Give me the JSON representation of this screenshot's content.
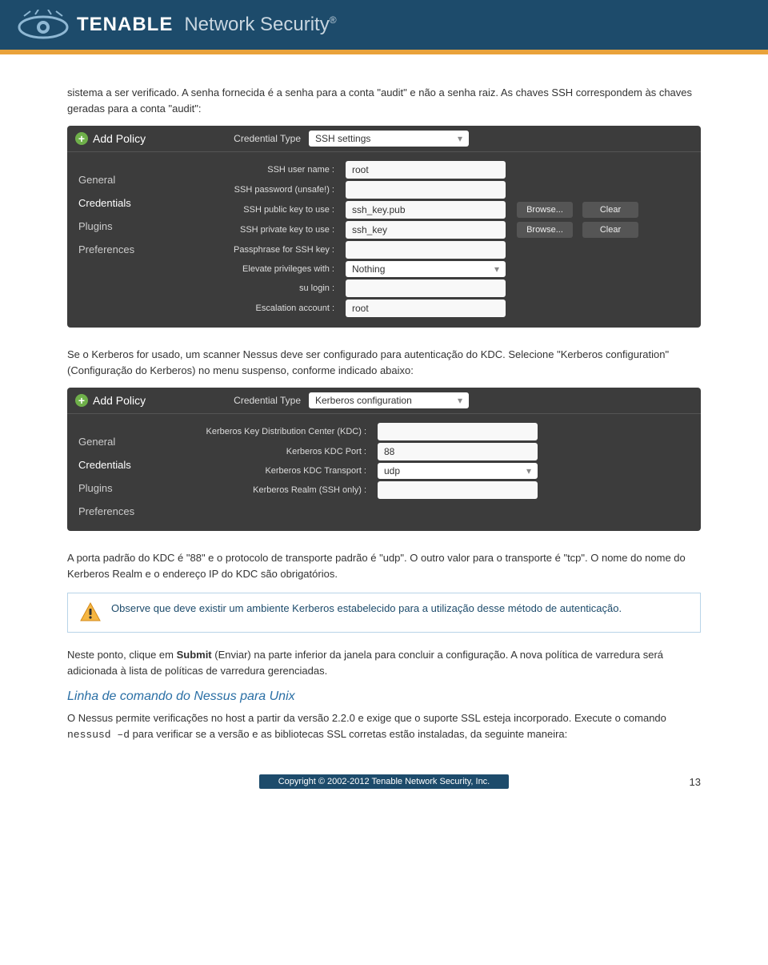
{
  "header": {
    "brand": "TENABLE",
    "tagline": "Network Security"
  },
  "body": {
    "p1": "sistema a ser verificado. A senha fornecida é a senha para a conta \"audit\" e não a senha raiz. As chaves SSH correspondem às chaves geradas para a conta \"audit\":",
    "p2": "Se o Kerberos for usado, um scanner Nessus deve ser configurado para autenticação do KDC. Selecione \"Kerberos configuration\" (Configuração do Kerberos) no menu suspenso, conforme indicado abaixo:",
    "p3": "A porta padrão do KDC é \"88\" e o protocolo de transporte padrão é \"udp\". O outro valor para o transporte é \"tcp\". O nome do nome do Kerberos Realm e o endereço IP do KDC são obrigatórios.",
    "note": "Observe que deve existir um ambiente Kerberos estabelecido para a utilização desse método de autenticação.",
    "p4a": "Neste ponto, clique em ",
    "p4b": "Submit",
    "p4c": " (Enviar) na parte inferior da janela para concluir a configuração. A nova política de varredura será adicionada à lista de políticas de varredura gerenciadas.",
    "h1": "Linha de comando do Nessus para Unix",
    "p5a": "O Nessus permite verificações no host a partir da versão 2.2.0 e exige que o suporte SSL esteja incorporado. Execute o comando ",
    "p5b": "nessusd –d",
    "p5c": " para verificar se a versão e as bibliotecas SSL corretas estão instaladas, da seguinte maneira:"
  },
  "ss1": {
    "add": "Add Policy",
    "credType": "Credential Type",
    "credValue": "SSH settings",
    "sidebar": [
      "General",
      "Credentials",
      "Plugins",
      "Preferences"
    ],
    "rows": [
      {
        "label": "SSH user name :",
        "value": "root",
        "browse": false,
        "clear": false
      },
      {
        "label": "SSH password (unsafe!) :",
        "value": "",
        "browse": false,
        "clear": false
      },
      {
        "label": "SSH public key to use :",
        "value": "ssh_key.pub",
        "browse": true,
        "clear": true
      },
      {
        "label": "SSH private key to use :",
        "value": "ssh_key",
        "browse": true,
        "clear": true
      },
      {
        "label": "Passphrase for SSH key :",
        "value": "",
        "browse": false,
        "clear": false
      },
      {
        "label": "Elevate privileges with :",
        "value": "Nothing",
        "browse": false,
        "clear": false,
        "dd": true
      },
      {
        "label": "su login :",
        "value": "",
        "browse": false,
        "clear": false
      },
      {
        "label": "Escalation account :",
        "value": "root",
        "browse": false,
        "clear": false
      }
    ],
    "browseLabel": "Browse...",
    "clearLabel": "Clear"
  },
  "ss2": {
    "add": "Add Policy",
    "credType": "Credential Type",
    "credValue": "Kerberos configuration",
    "sidebar": [
      "General",
      "Credentials",
      "Plugins",
      "Preferences"
    ],
    "rows": [
      {
        "label": "Kerberos Key Distribution Center (KDC) :",
        "value": ""
      },
      {
        "label": "Kerberos KDC Port :",
        "value": "88"
      },
      {
        "label": "Kerberos KDC Transport :",
        "value": "udp",
        "dd": true
      },
      {
        "label": "Kerberos Realm (SSH only) :",
        "value": ""
      }
    ]
  },
  "footer": {
    "copyright": "Copyright © 2002-2012 Tenable Network Security, Inc.",
    "pagenum": "13"
  }
}
